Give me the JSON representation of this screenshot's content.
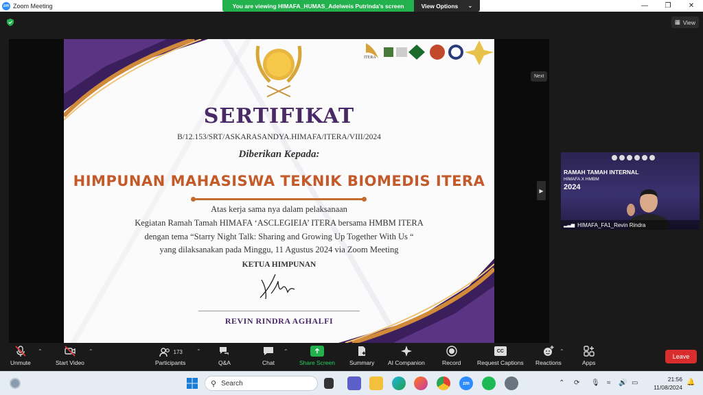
{
  "window": {
    "title": "Zoom Meeting",
    "app_icon": "zm",
    "controls": [
      "minimize-icon",
      "maximize-icon",
      "close-icon"
    ]
  },
  "share_banner": {
    "text": "You are viewing HIMAFA_HUMAS_Adelweis Putrinda's screen",
    "view_options": "View Options",
    "color": "#23b14d"
  },
  "view_button": {
    "label": "View"
  },
  "certificate": {
    "title": "SERTIFIKAT",
    "number": "B/12.153/SRT/ASKARASANDYA.HIMAFA/ITERA/VIII/2024",
    "given_to": "Diberikan Kepada:",
    "recipient": "HIMPUNAN MAHASISWA TEKNIK BIOMEDIS ITERA",
    "line1": "Atas kerja sama nya dalam pelaksanaan",
    "line2": "Kegiatan Ramah Tamah HIMAFA ‘ASCLEGIEIA’ ITERA bersama HMBM ITERA",
    "line3": "dengan tema “Starry Night Talk: Sharing and Growing Up Together With Us “",
    "line4": "yang dilaksanakan pada Minggu, 11 Agustus 2024 via Zoom Meeting",
    "signer_title": "KETUA HIMPUNAN",
    "signer_name": "REVIN RINDRA AGHALFI",
    "logo_label": "ITERA",
    "colors": {
      "purple": "#4a2a66",
      "orange": "#c45a2a",
      "gold": "#d8a23a"
    }
  },
  "next_tooltip": "Next",
  "video_tile": {
    "heading": "RAMAH TAMAH INTERNAL",
    "subheading": "HIMAFA X HMBM",
    "year": "2024",
    "participant_name": "HIMAFA_FA1_Revin Rindra"
  },
  "toolbar": {
    "items": [
      {
        "label": "Unmute",
        "icon": "mic-muted-icon"
      },
      {
        "label": "Start Video",
        "icon": "video-off-icon"
      },
      {
        "label": "Participants",
        "icon": "participants-icon",
        "count": "173"
      },
      {
        "label": "Q&A",
        "icon": "qa-icon"
      },
      {
        "label": "Chat",
        "icon": "chat-icon"
      },
      {
        "label": "Share Screen",
        "icon": "share-screen-icon"
      },
      {
        "label": "Summary",
        "icon": "summary-icon"
      },
      {
        "label": "AI Companion",
        "icon": "ai-companion-icon"
      },
      {
        "label": "Record",
        "icon": "record-icon"
      },
      {
        "label": "Request Captions",
        "icon": "captions-icon"
      },
      {
        "label": "Reactions",
        "icon": "reactions-icon"
      },
      {
        "label": "Apps",
        "icon": "apps-icon"
      }
    ],
    "leave": "Leave",
    "captions_badge": "CC"
  },
  "taskbar": {
    "search_placeholder": "Search",
    "time": "21:56",
    "date": "11/08/2024",
    "pinned": [
      "windows-start-icon",
      "task-view-icon",
      "teams-icon",
      "file-explorer-icon",
      "edge-icon",
      "firefox-icon",
      "chrome-icon",
      "zoom-icon",
      "spotify-icon",
      "settings-icon"
    ]
  }
}
